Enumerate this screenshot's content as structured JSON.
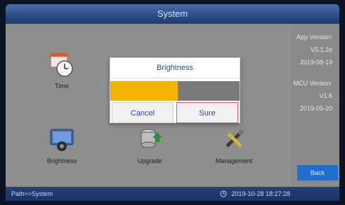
{
  "window": {
    "title": "System"
  },
  "tiles": [
    {
      "label": "Time",
      "icon": "clock-calendar-icon"
    },
    {
      "label": "Brightness",
      "icon": "monitor-gear-icon"
    },
    {
      "label": "Upgrade",
      "icon": "database-upgrade-icon"
    },
    {
      "label": "Management",
      "icon": "tools-icon"
    }
  ],
  "info": {
    "app_version_label": "App Version:",
    "app_version": "V5.1.2e",
    "app_date": "2019-08-19",
    "mcu_version_label": "MCU Version:",
    "mcu_version": "V1.6",
    "mcu_date": "2019-05-20"
  },
  "controls": {
    "back_label": "Back"
  },
  "dialog": {
    "title": "Brightness",
    "level": 0.52,
    "cancel_label": "Cancel",
    "sure_label": "Sure",
    "colors": {
      "fill": "#f2b400",
      "track": "#7a7a7a",
      "accent": "#2a4b9b"
    }
  },
  "status": {
    "path": "Path>>System",
    "datetime": "2019-10-28 18:27:28",
    "clock_icon": "clock-icon"
  }
}
